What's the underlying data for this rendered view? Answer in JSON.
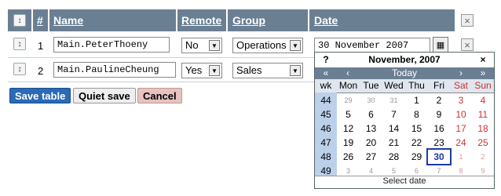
{
  "headers": {
    "num": "#",
    "name": "Name",
    "remote": "Remote",
    "group": "Group",
    "date": "Date"
  },
  "rows": [
    {
      "num": "1",
      "name": "Main.PeterThoeny",
      "remote": "No",
      "group": "Operations",
      "date": "30 November 2007"
    },
    {
      "num": "2",
      "name": "Main.PaulineCheung",
      "remote": "Yes",
      "group": "Sales"
    }
  ],
  "buttons": {
    "save": "Save table",
    "quiet": "Quiet save",
    "cancel": "Cancel"
  },
  "calendar": {
    "help": "?",
    "month_year": "November, 2007",
    "close": "×",
    "nav": {
      "prev_year": "«",
      "prev_month": "‹",
      "today": "Today",
      "next_month": "›",
      "next_year": "»"
    },
    "dow": [
      "wk",
      "Mon",
      "Tue",
      "Wed",
      "Thu",
      "Fri",
      "Sat",
      "Sun"
    ],
    "weeks": [
      {
        "wk": "44",
        "days": [
          "29",
          "30",
          "31",
          "1",
          "2",
          "3",
          "4"
        ]
      },
      {
        "wk": "45",
        "days": [
          "5",
          "6",
          "7",
          "8",
          "9",
          "10",
          "11"
        ]
      },
      {
        "wk": "46",
        "days": [
          "12",
          "13",
          "14",
          "15",
          "16",
          "17",
          "18"
        ]
      },
      {
        "wk": "47",
        "days": [
          "19",
          "20",
          "21",
          "22",
          "23",
          "24",
          "25"
        ]
      },
      {
        "wk": "48",
        "days": [
          "26",
          "27",
          "28",
          "29",
          "30",
          "1",
          "2"
        ]
      },
      {
        "wk": "49",
        "days": [
          "3",
          "4",
          "5",
          "6",
          "7",
          "8",
          "9"
        ]
      }
    ],
    "footer": "Select date"
  },
  "colors": {
    "header_bg": "#6b7f93",
    "save_bg": "#2a6ab7",
    "cancel_bg": "#e8c2bf",
    "week_col": "#bcd0ea"
  }
}
